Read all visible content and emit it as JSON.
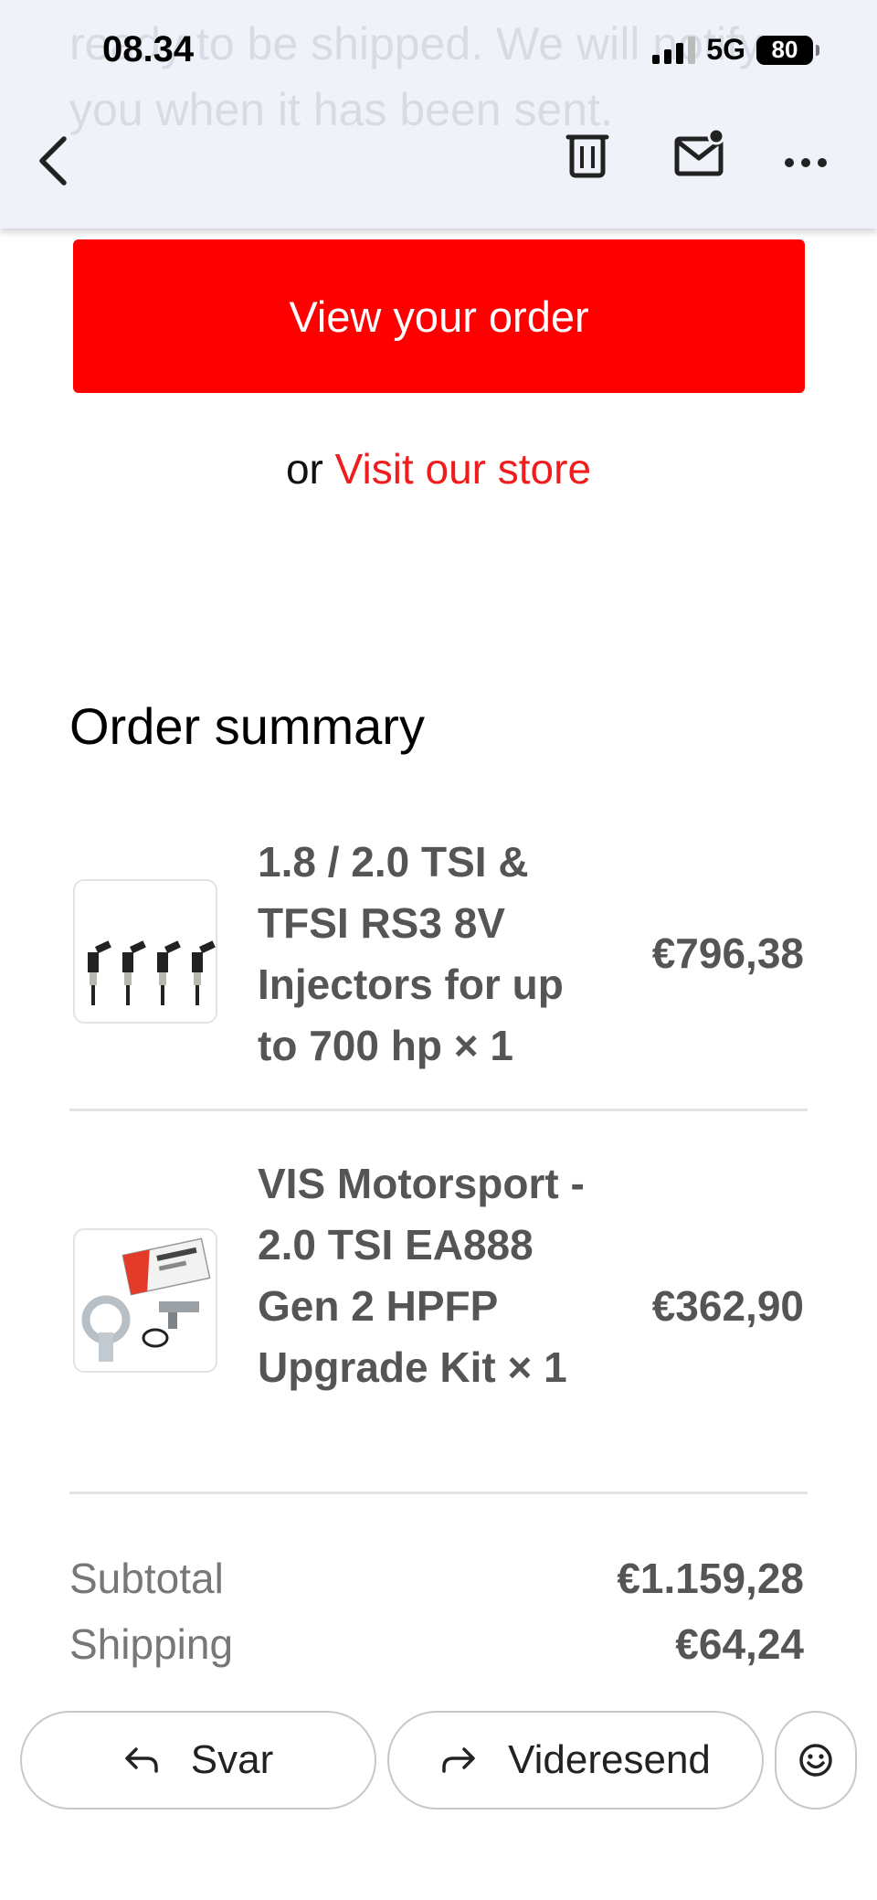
{
  "status_bar": {
    "time": "08.34",
    "network": "5G",
    "battery": "80"
  },
  "background_text": "ready to be shipped. We will notify you when it has been sent.",
  "toolbar": {
    "back_icon": "chevron-left-icon",
    "delete_icon": "trash-icon",
    "unread_icon": "mail-unread-icon",
    "more_icon": "more-horizontal-icon"
  },
  "email": {
    "view_order_label": "View your order",
    "or_text": "or",
    "visit_store_label": "Visit our store",
    "order_summary_title": "Order summary",
    "items": [
      {
        "name": "1.8 / 2.0 TSI & TFSI RS3 8V Injectors for up to 700 hp × 1",
        "price": "€796,38"
      },
      {
        "name": "VIS Motorsport - 2.0 TSI EA888 Gen 2 HPFP Upgrade Kit × 1",
        "price": "€362,90"
      }
    ],
    "subtotal_label": "Subtotal",
    "subtotal_value": "€1.159,28",
    "shipping_label": "Shipping",
    "shipping_value": "€64,24"
  },
  "actions": {
    "reply_label": "Svar",
    "forward_label": "Videresend"
  },
  "colors": {
    "brand_red": "#fe0000",
    "link_red": "#ef1d1d",
    "toolbar_bg": "#eff2f8"
  }
}
